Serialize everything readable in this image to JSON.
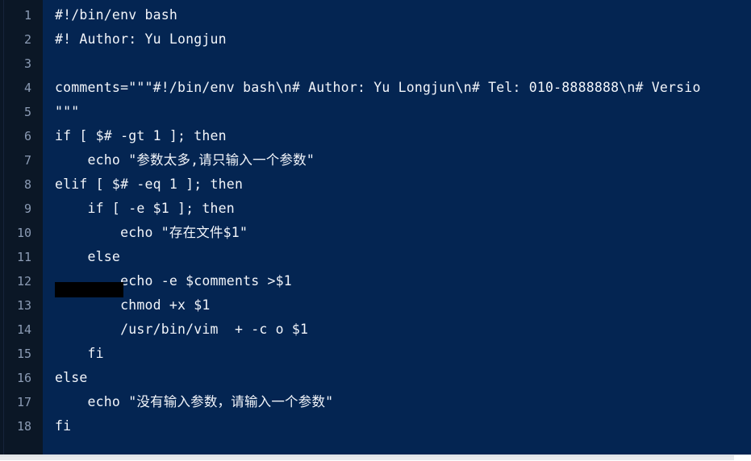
{
  "editor": {
    "background_color": "#042552",
    "gutter_background_color": "#0b1726",
    "text_color": "#f2f5fa",
    "line_number_color": "#8b9bb4",
    "redaction_color": "#000000",
    "language": "bash",
    "total_lines": 18
  },
  "lines": [
    {
      "number": "1",
      "text": "#!/bin/env bash"
    },
    {
      "number": "2",
      "text": "#! Author: Yu Longjun"
    },
    {
      "number": "3",
      "text": ""
    },
    {
      "number": "4",
      "text": "comments=\"\"\"#!/bin/env bash\\n# Author: Yu Longjun\\n# Tel: 010-8888888\\n# Versio"
    },
    {
      "number": "5",
      "text": "\"\"\""
    },
    {
      "number": "6",
      "text": "if [ $# -gt 1 ]; then"
    },
    {
      "number": "7",
      "text": "    echo \"参数太多,请只输入一个参数\""
    },
    {
      "number": "8",
      "text": "elif [ $# -eq 1 ]; then"
    },
    {
      "number": "9",
      "text": "    if [ -e $1 ]; then"
    },
    {
      "number": "10",
      "text": "        echo \"存在文件$1\""
    },
    {
      "number": "11",
      "text": "    else"
    },
    {
      "number": "12",
      "text": "        echo -e $comments >$1"
    },
    {
      "number": "13",
      "text": "        chmod +x $1"
    },
    {
      "number": "14",
      "text": "        /usr/bin/vim  + -c o $1"
    },
    {
      "number": "15",
      "text": "    fi"
    },
    {
      "number": "16",
      "text": "else"
    },
    {
      "number": "17",
      "text": "    echo \"没有输入参数，请输入一个参数\""
    },
    {
      "number": "18",
      "text": "fi"
    }
  ],
  "scrollbar": {
    "orientation": "horizontal",
    "thumb_width_px": "910"
  }
}
